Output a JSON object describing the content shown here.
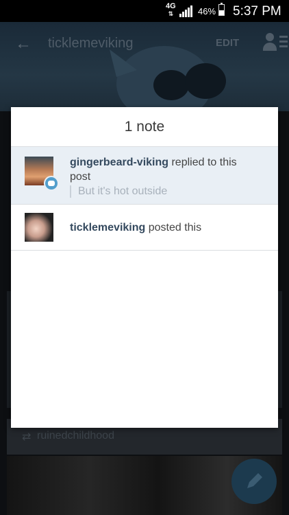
{
  "status_bar": {
    "network": "4G",
    "battery_percent": "46%",
    "battery_level": 0.46,
    "time": "5:37 PM",
    "icons": [
      "4g-icon",
      "signal-icon",
      "battery-icon"
    ]
  },
  "background": {
    "header_title": "ticklemeviking",
    "edit_label": "EDIT",
    "reblog_name": "ruinedchildhood",
    "icons": [
      "back-arrow-icon",
      "person-icon",
      "reblog-icon",
      "pencil-icon"
    ]
  },
  "dialog": {
    "title": "1 note",
    "notes": [
      {
        "username": "gingerbeard-viking",
        "action": " replied to this post",
        "reply_text": "But it's hot outside",
        "has_reply_badge": true
      },
      {
        "username": "ticklemeviking",
        "action": " posted this"
      }
    ]
  },
  "colors": {
    "reply_badge": "#529ecc",
    "highlight_row": "#e9eff5",
    "username": "#34495e"
  }
}
